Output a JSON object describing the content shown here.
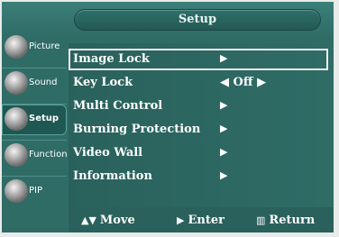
{
  "header": {
    "title": "Setup"
  },
  "tabs": [
    {
      "label": "Picture",
      "icon": "picture-icon",
      "active": false
    },
    {
      "label": "Sound",
      "icon": "sound-icon",
      "active": false
    },
    {
      "label": "Setup",
      "icon": "setup-icon",
      "active": true
    },
    {
      "label": "Function",
      "icon": "function-icon",
      "active": false
    },
    {
      "label": "PIP",
      "icon": "pip-icon",
      "active": false
    }
  ],
  "menu": {
    "items": [
      {
        "label": "Image Lock",
        "value": ""
      },
      {
        "label": "Key Lock",
        "value": "Off"
      },
      {
        "label": "Multi Control",
        "value": ""
      },
      {
        "label": "Burning Protection",
        "value": ""
      },
      {
        "label": "Video Wall",
        "value": ""
      },
      {
        "label": "Information",
        "value": ""
      }
    ],
    "selected_index": 0
  },
  "footer": {
    "move_label": "Move",
    "enter_label": "Enter",
    "return_label": "Return"
  },
  "colors": {
    "panel": "#2f6c66",
    "accent": "#f1f1f1",
    "text": "#ffffff"
  }
}
